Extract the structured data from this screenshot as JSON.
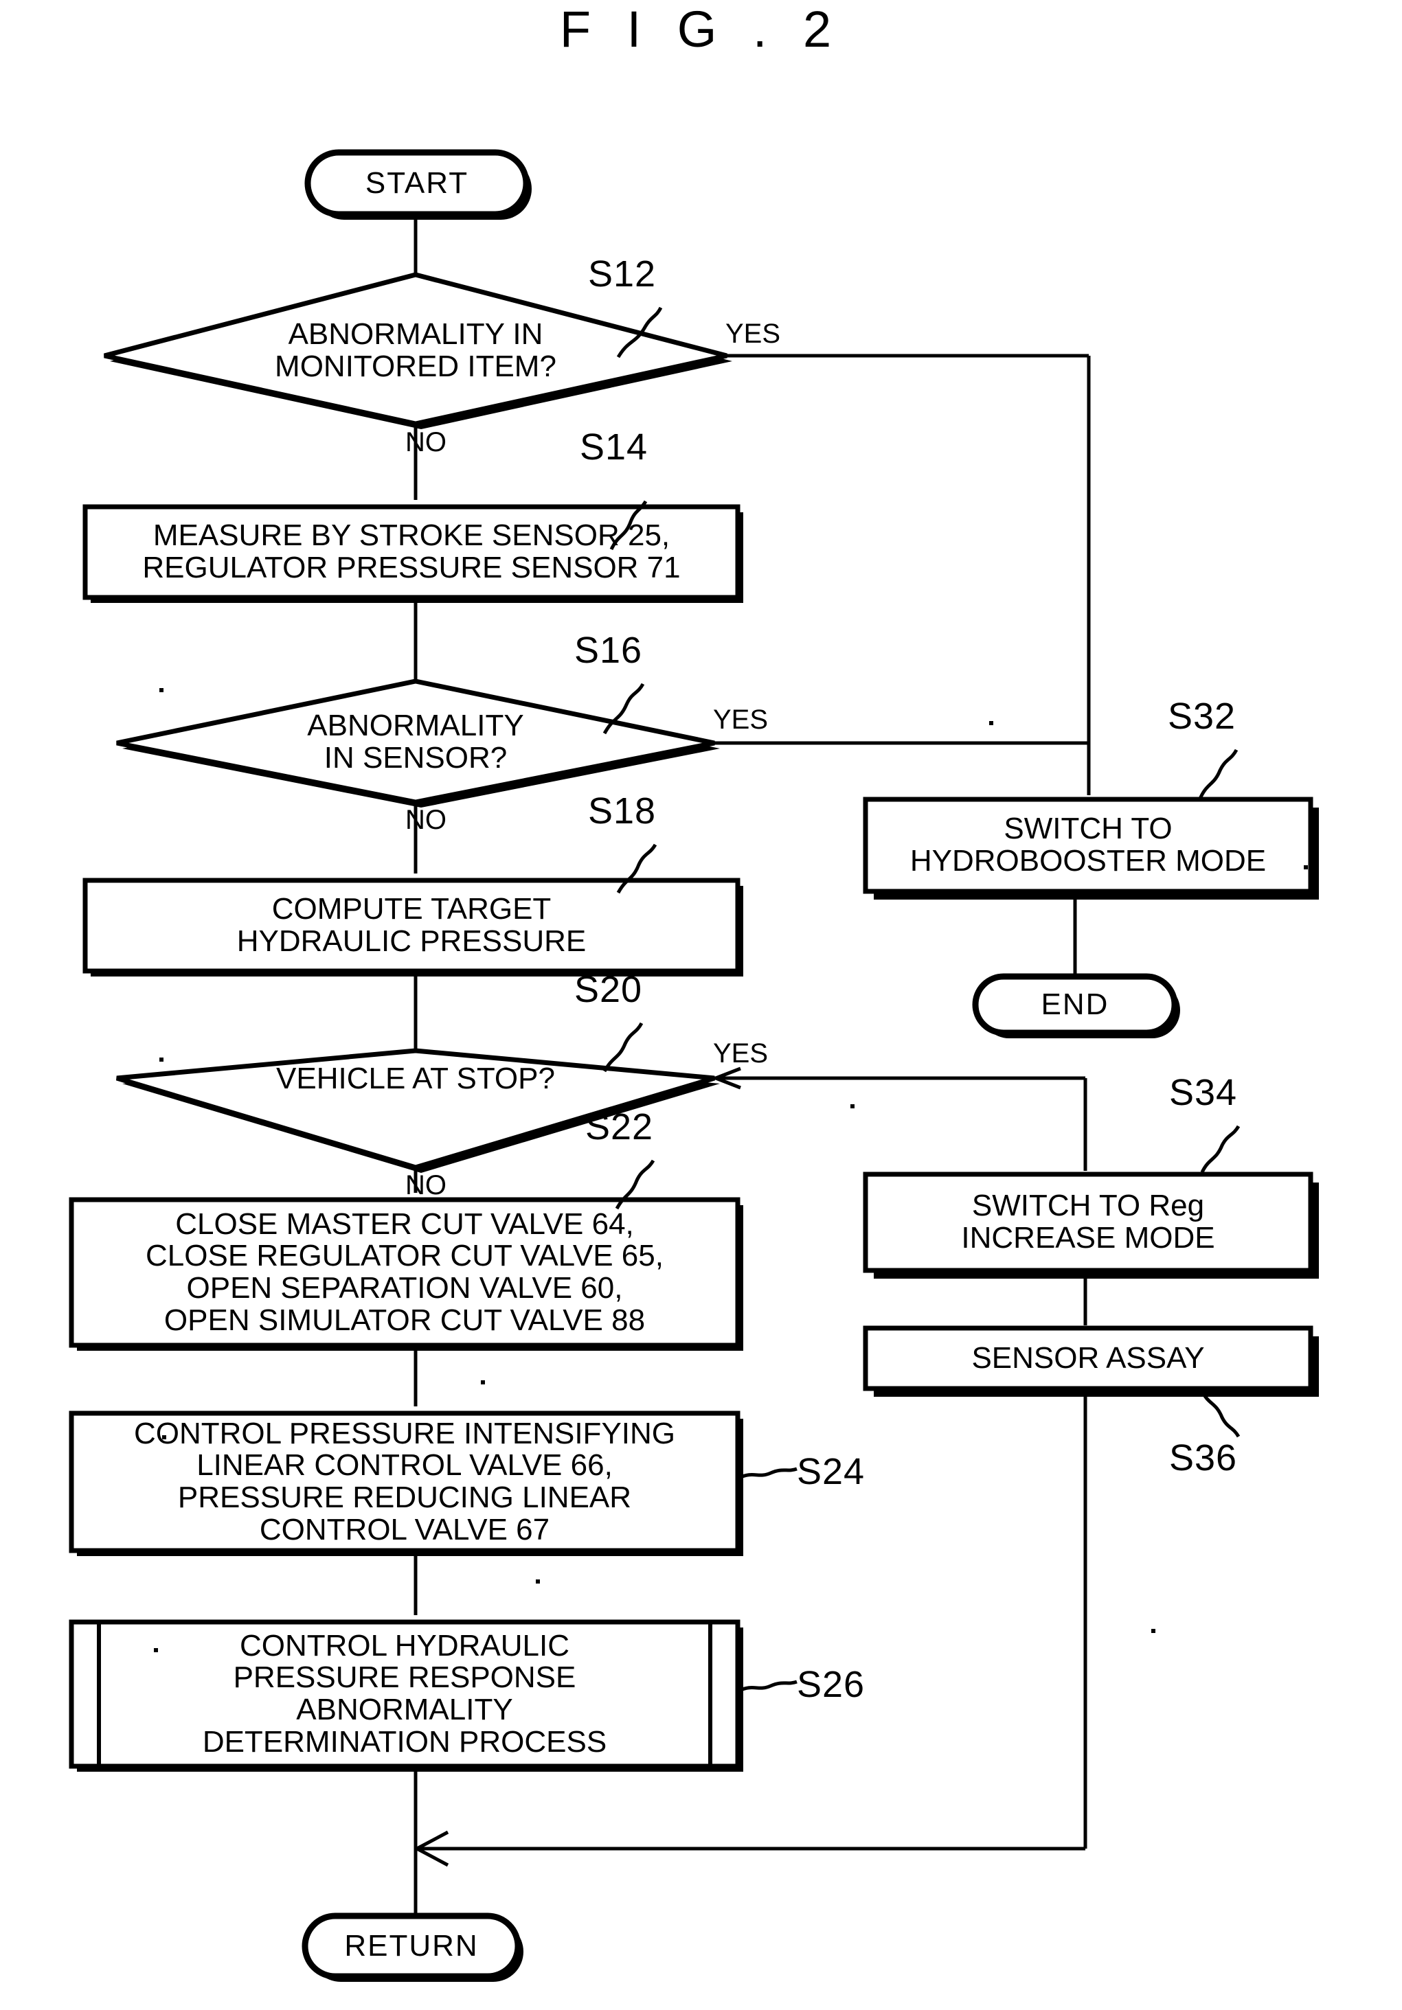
{
  "figure": {
    "title": "F I G . 2",
    "type": "patent-flowchart"
  },
  "nodes": {
    "start": {
      "label": "START",
      "shape": "terminator"
    },
    "s12": {
      "id": "S12",
      "label": "ABNORMALITY IN\nMONITORED ITEM?",
      "shape": "decision",
      "yes": "YES",
      "no": "NO"
    },
    "s14": {
      "id": "S14",
      "label": "MEASURE BY STROKE SENSOR 25,\nREGULATOR PRESSURE SENSOR 71",
      "shape": "process"
    },
    "s16": {
      "id": "S16",
      "label": "ABNORMALITY\nIN SENSOR?",
      "shape": "decision",
      "yes": "YES",
      "no": "NO"
    },
    "s18": {
      "id": "S18",
      "label": "COMPUTE TARGET\nHYDRAULIC PRESSURE",
      "shape": "process"
    },
    "s20": {
      "id": "S20",
      "label": "VEHICLE AT STOP?",
      "shape": "decision",
      "yes": "YES",
      "no": "NO"
    },
    "s22": {
      "id": "S22",
      "label": "CLOSE MASTER CUT VALVE 64,\nCLOSE REGULATOR CUT VALVE 65,\nOPEN SEPARATION VALVE 60,\nOPEN SIMULATOR CUT VALVE 88",
      "shape": "process"
    },
    "s24": {
      "id": "S24",
      "label": "CONTROL PRESSURE INTENSIFYING\nLINEAR CONTROL VALVE 66,\nPRESSURE REDUCING LINEAR\nCONTROL VALVE 67",
      "shape": "process"
    },
    "s26": {
      "id": "S26",
      "label": "CONTROL HYDRAULIC\nPRESSURE RESPONSE\nABNORMALITY\nDETERMINATION PROCESS",
      "shape": "predefined-process"
    },
    "s32": {
      "id": "S32",
      "label": "SWITCH TO\nHYDROBOOSTER MODE",
      "shape": "process"
    },
    "s34": {
      "id": "S34",
      "label": "SWITCH TO Reg\nINCREASE MODE",
      "shape": "process"
    },
    "s36": {
      "id": "S36",
      "label": "SENSOR ASSAY",
      "shape": "process"
    },
    "end": {
      "label": "END",
      "shape": "terminator"
    },
    "return": {
      "label": "RETURN",
      "shape": "terminator"
    }
  },
  "colors": {
    "stroke": "#000000",
    "fill": "#ffffff",
    "background": "#ffffff"
  }
}
